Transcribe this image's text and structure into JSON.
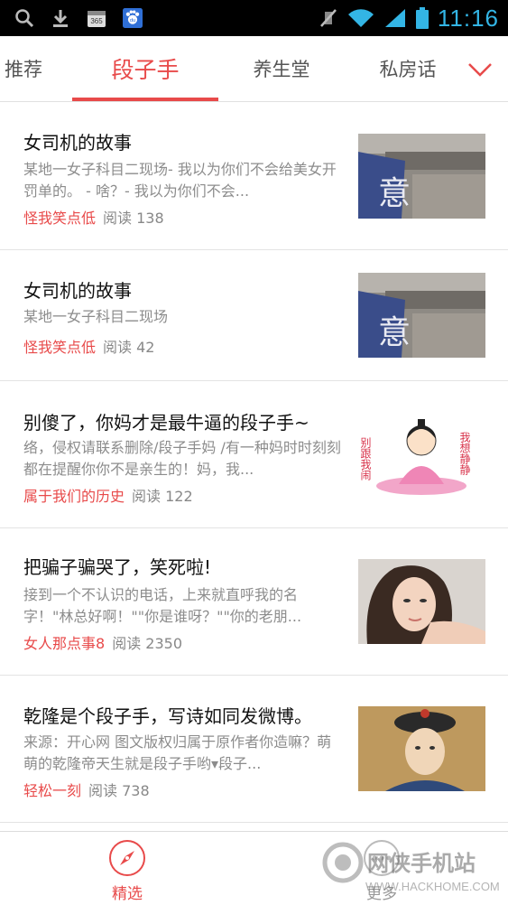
{
  "status_bar": {
    "time": "11:16",
    "left_icons": [
      "search-icon",
      "download-icon",
      "calendar-icon",
      "baidu-icon"
    ],
    "right_icons": [
      "mute-icon",
      "wifi-icon",
      "signal-icon",
      "battery-icon"
    ],
    "calendar_text": "365",
    "baidu_text": "du"
  },
  "tabs": [
    {
      "label": "推荐",
      "active": false
    },
    {
      "label": "段子手",
      "active": true
    },
    {
      "label": "养生堂",
      "active": false
    },
    {
      "label": "私房话",
      "active": false
    }
  ],
  "accent_color": "#e84a4a",
  "feed": [
    {
      "title": "女司机的故事",
      "summary": "某地一女子科目二现场- 我以为你们不会给美女开罚单的。 - 啥？- 我以为你们不会...",
      "source": "怪我笑点低",
      "reads": "阅读 138",
      "thumb": "car-crash-photo"
    },
    {
      "title": "女司机的故事",
      "summary": "某地一女子科目二现场",
      "source": "怪我笑点低",
      "reads": "阅读 42",
      "thumb": "car-crash-photo"
    },
    {
      "title": "别傻了，你妈才是最牛逼的段子手~",
      "summary": "络，侵权请联系删除/段子手妈 /有一种妈时时刻刻都在提醒你你不是亲生的！妈，我...",
      "source": "属于我们的历史",
      "reads": "阅读 122",
      "thumb": "cartoon-girl-meditating",
      "thumb_text_left": "别跟我闹",
      "thumb_text_right": "我想静静"
    },
    {
      "title": "把骗子骗哭了，笑死啦!",
      "summary": "接到一个不认识的电话，上来就直呼我的名字！\"林总好啊！\"\"你是谁呀？\"\"你的老朋...",
      "source": "女人那点事8",
      "reads": "阅读 2350",
      "thumb": "woman-portrait-photo"
    },
    {
      "title": "乾隆是个段子手，写诗如同发微博。",
      "summary": "来源：开心网 图文版权归属于原作者你造嘛？萌萌的乾隆帝天生就是段子手哟▾段子...",
      "source": "轻松一刻",
      "reads": "阅读 738",
      "thumb": "qing-emperor-portrait"
    }
  ],
  "bottom_nav": [
    {
      "label": "精选",
      "icon": "compass-icon",
      "active": true
    },
    {
      "label": "更多",
      "icon": "more-icon",
      "active": false
    }
  ],
  "watermark": {
    "text": "网侠手机站",
    "url": "WWW.HACKHOME.COM"
  }
}
